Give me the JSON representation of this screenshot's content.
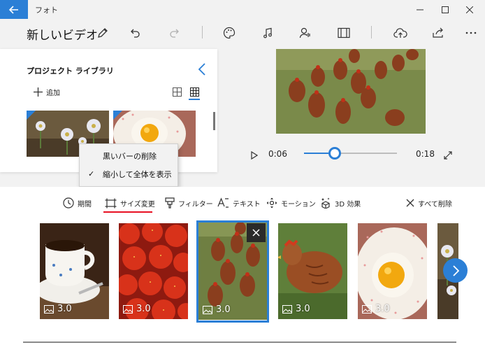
{
  "titlebar": {
    "back_icon": "arrow-left-icon",
    "title": "フォト",
    "controls": [
      "minimize-icon",
      "maximize-icon",
      "close-icon"
    ]
  },
  "header": {
    "project_title": "新しいビデオ",
    "icons": [
      "pencil-icon",
      "undo-icon",
      "redo-icon",
      "palette-icon",
      "music-icon",
      "narration-icon",
      "aspect-ratio-icon",
      "cloud-upload-icon",
      "share-icon",
      "more-icon"
    ]
  },
  "library": {
    "title": "プロジェクト ライブラリ",
    "add_label": "追加",
    "view_modes": [
      "grid-small-icon",
      "grid-large-icon"
    ],
    "active_view": "grid-large"
  },
  "context_menu": {
    "items": [
      {
        "label": "黒いバーの削除",
        "checked": false
      },
      {
        "label": "縮小して全体を表示",
        "checked": true
      }
    ]
  },
  "playback": {
    "current_time": "0:06",
    "total_time": "0:18",
    "progress": 0.33,
    "icons": [
      "play-icon",
      "fullscreen-icon"
    ]
  },
  "storyboard": {
    "tools": [
      {
        "label": "期間",
        "icon": "clock-icon"
      },
      {
        "label": "サイズ変更",
        "icon": "resize-icon"
      },
      {
        "label": "フィルター",
        "icon": "filter-icon"
      },
      {
        "label": "テキスト",
        "icon": "text-icon"
      },
      {
        "label": "モーション",
        "icon": "motion-icon"
      },
      {
        "label": "3D 効果",
        "icon": "3d-effects-icon"
      },
      {
        "label": "すべて削除",
        "icon": "close-icon"
      }
    ],
    "active_tool": "サイズ変更",
    "clips": [
      {
        "subject": "coffee",
        "duration": "3.0"
      },
      {
        "subject": "strawberries",
        "duration": "3.0"
      },
      {
        "subject": "chickens",
        "duration": "3.0",
        "selected": true
      },
      {
        "subject": "hen",
        "duration": "3.0"
      },
      {
        "subject": "egg",
        "duration": "3.0"
      },
      {
        "subject": "flowers",
        "duration": ""
      }
    ]
  },
  "colors": {
    "accent": "#2b7fd6",
    "active_underline": "#e81123"
  }
}
